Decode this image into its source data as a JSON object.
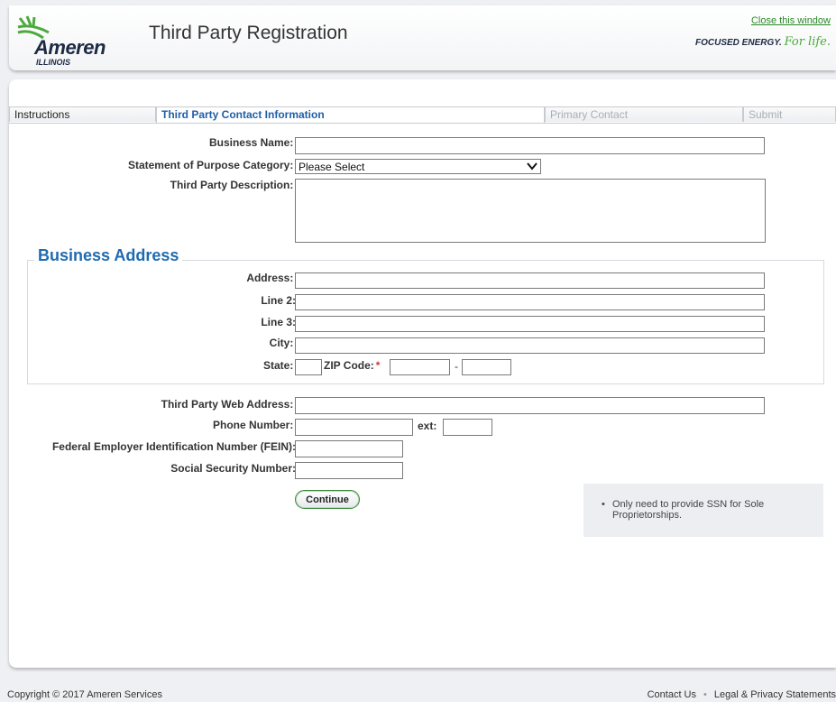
{
  "header": {
    "logo_word": "Ameren",
    "logo_state": "ILLINOIS",
    "title": "Third Party Registration",
    "close_link": "Close this window",
    "tagline": "FOCUSED ENERGY.",
    "tagline_script": "For life."
  },
  "tabs": [
    {
      "label": "Instructions",
      "state": "normal"
    },
    {
      "label": "Third Party Contact Information",
      "state": "active"
    },
    {
      "label": "Primary Contact",
      "state": "disabled"
    },
    {
      "label": "Submit",
      "state": "disabled"
    }
  ],
  "form": {
    "business_name": {
      "label": "Business Name:",
      "value": ""
    },
    "purpose": {
      "label": "Statement of Purpose Category:",
      "selected": "Please Select"
    },
    "description": {
      "label": "Third Party Description:",
      "value": ""
    },
    "address_section": "Business Address",
    "address": {
      "label": "Address:",
      "value": ""
    },
    "line2": {
      "label": "Line 2:",
      "value": ""
    },
    "line3": {
      "label": "Line 3:",
      "value": ""
    },
    "city": {
      "label": "City:",
      "value": ""
    },
    "state": {
      "label": "State:",
      "value": ""
    },
    "zip": {
      "label": "ZIP Code:",
      "value": "",
      "ext_value": "",
      "separator": "-"
    },
    "web": {
      "label": "Third Party Web Address:",
      "value": ""
    },
    "phone": {
      "label": "Phone Number:",
      "value": "",
      "ext_label": "ext:",
      "ext_value": ""
    },
    "fein": {
      "label": "Federal Employer Identification Number (FEIN):",
      "value": ""
    },
    "ssn": {
      "label": "Social Security Number:",
      "value": ""
    },
    "required_mark": "*",
    "continue_label": "Continue",
    "note": "Only need to provide SSN for Sole Proprietorships.",
    "note_bullet": "•"
  },
  "footer": {
    "copyright": "Copyright © 2017 Ameren Services",
    "contact": "Contact Us",
    "separator": "•",
    "legal": "Legal & Privacy Statements"
  },
  "colors": {
    "accent_blue": "#1f6bb0",
    "brand_green": "#4caa3c",
    "required_red": "#d23a3a"
  }
}
